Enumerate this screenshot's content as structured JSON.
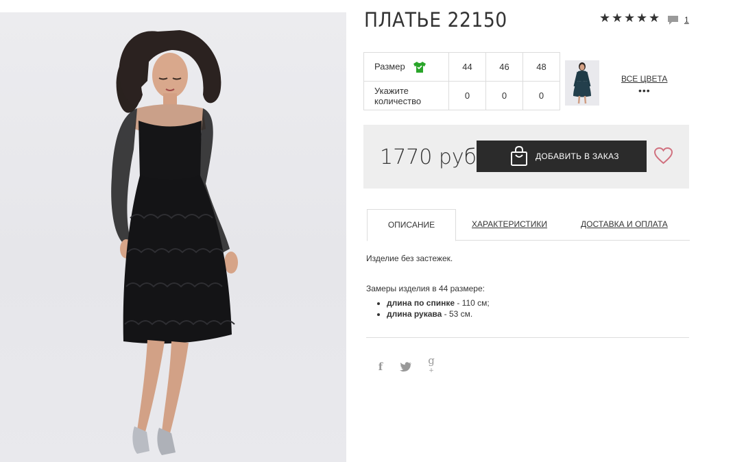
{
  "product": {
    "title": "ПЛАТЬЕ 22150",
    "rating_stars": 5,
    "comments_count": "1"
  },
  "sizes": {
    "size_label": "Размер",
    "quantity_label": "Укажите количество",
    "values": [
      "44",
      "46",
      "48"
    ],
    "quantities": [
      "0",
      "0",
      "0"
    ]
  },
  "colors": {
    "all_colors_label": "ВСЕ ЦВЕТА",
    "more": "•••"
  },
  "buy": {
    "price": "1770 руб",
    "add_to_order": "ДОБАВИТЬ В ЗАКАЗ"
  },
  "tabs": [
    {
      "label": "ОПИСАНИЕ",
      "active": true
    },
    {
      "label": "ХАРАКТЕРИСТИКИ",
      "active": false
    },
    {
      "label": "ДОСТАВКА И ОПЛАТА",
      "active": false
    }
  ],
  "description": {
    "text": "Изделие без застежек.",
    "measures_title": "Замеры изделия в 44 размере:",
    "measures": [
      {
        "name": "длина по спинке",
        "value": " - 110 см;"
      },
      {
        "name": "длина рукава",
        "value": " - 53 см."
      }
    ]
  },
  "social": {
    "icons": [
      "facebook-icon",
      "twitter-icon",
      "google-plus-icon"
    ],
    "facebook": "f",
    "twitter": "🐦",
    "gplus": "g"
  },
  "colors_hex": {
    "accent_dark": "#2b2b2b",
    "heart": "#d0707e",
    "size_icon": "#2aa52a"
  }
}
